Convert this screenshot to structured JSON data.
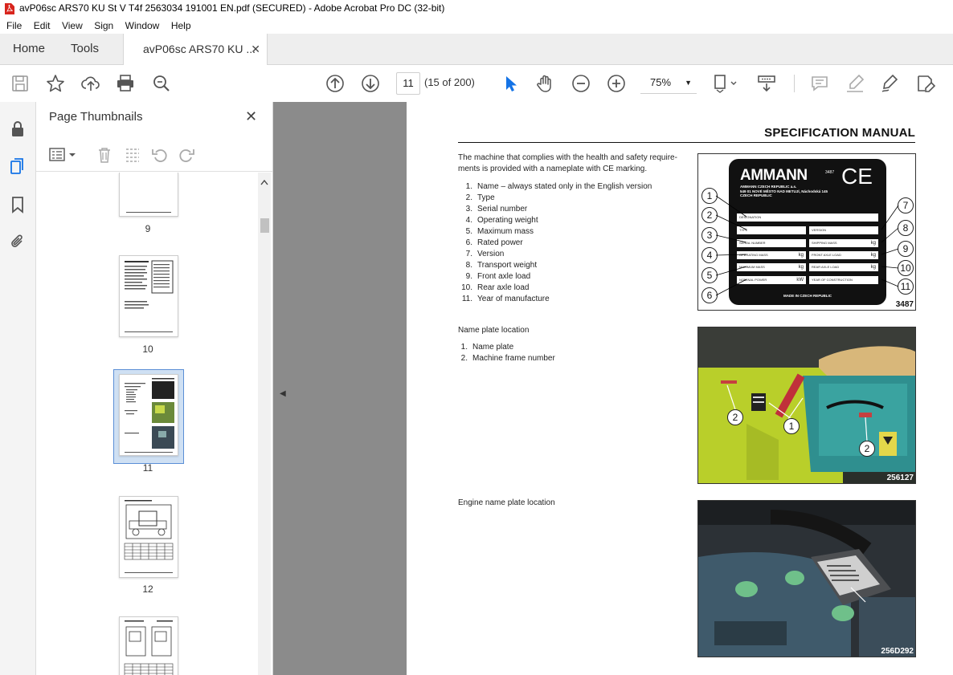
{
  "window": {
    "title": "avP06sc ARS70 KU St V T4f 2563034 191001 EN.pdf (SECURED) - Adobe Acrobat Pro DC (32-bit)"
  },
  "menu": [
    "File",
    "Edit",
    "View",
    "Sign",
    "Window",
    "Help"
  ],
  "tabs": {
    "home": "Home",
    "tools": "Tools",
    "document": "avP06sc ARS70 KU ...",
    "close": "✕"
  },
  "toolbar": {
    "current_page": "11",
    "page_count": "(15 of 200)",
    "zoom": "75%"
  },
  "panel": {
    "title": "Page Thumbnails",
    "close": "✕",
    "thumbnails": [
      {
        "label": "9"
      },
      {
        "label": "10"
      },
      {
        "label": "11",
        "selected": true
      },
      {
        "label": "12"
      }
    ]
  },
  "doc": {
    "heading": "SPECIFICATION MANUAL",
    "intro": "The machine that complies with the health and safety require-ments is provided with a nameplate with CE marking.",
    "intro_line1": "The machine that complies with the health and safety require-",
    "intro_line2": "ments is provided with a nameplate with CE marking.",
    "nameplate_items": [
      {
        "n": "1.",
        "t": "Name – always stated only in the English version"
      },
      {
        "n": "2.",
        "t": "Type"
      },
      {
        "n": "3.",
        "t": "Serial number"
      },
      {
        "n": "4.",
        "t": "Operating weight"
      },
      {
        "n": "5.",
        "t": "Maximum mass"
      },
      {
        "n": "6.",
        "t": "Rated power"
      },
      {
        "n": "7.",
        "t": "Version"
      },
      {
        "n": "8.",
        "t": "Transport weight"
      },
      {
        "n": "9.",
        "t": "Front axle load"
      },
      {
        "n": "10.",
        "t": "Rear axle load"
      },
      {
        "n": "11.",
        "t": "Year of manufacture"
      }
    ],
    "location_heading": "Name plate location",
    "location_items": [
      {
        "n": "1.",
        "t": "Name plate"
      },
      {
        "n": "2.",
        "t": "Machine frame number"
      }
    ],
    "engine_heading": "Engine name plate location",
    "plate": {
      "brand": "AMMANN",
      "ce": "CE",
      "address1": "AMMANN CZECH REPUBLIC a.s.",
      "address2": "549 01 NOVÉ MĚSTO NAD METUJÍ, Náchodská 145",
      "address3": "CZECH REPUBLIC",
      "fields_left": [
        "DESIGNATION",
        "TYPE",
        "SERIAL NUMBER",
        "OPERATING MASS",
        "MAXIMUM MASS",
        "NOMINAL POWER"
      ],
      "fields_right": [
        "VERSION",
        "SHIPPING MASS",
        "FRONT AXLE LOAD",
        "REAR AXLE LOAD",
        "YEAR OF CONSTRUCTION"
      ],
      "unit_kg": "kg",
      "unit_kw": "kW",
      "made_in": "MADE IN CZECH REPUBLIC",
      "small_code": "3487",
      "code": "3487"
    },
    "photo1_code": "256127",
    "photo2_code": "256D292"
  }
}
